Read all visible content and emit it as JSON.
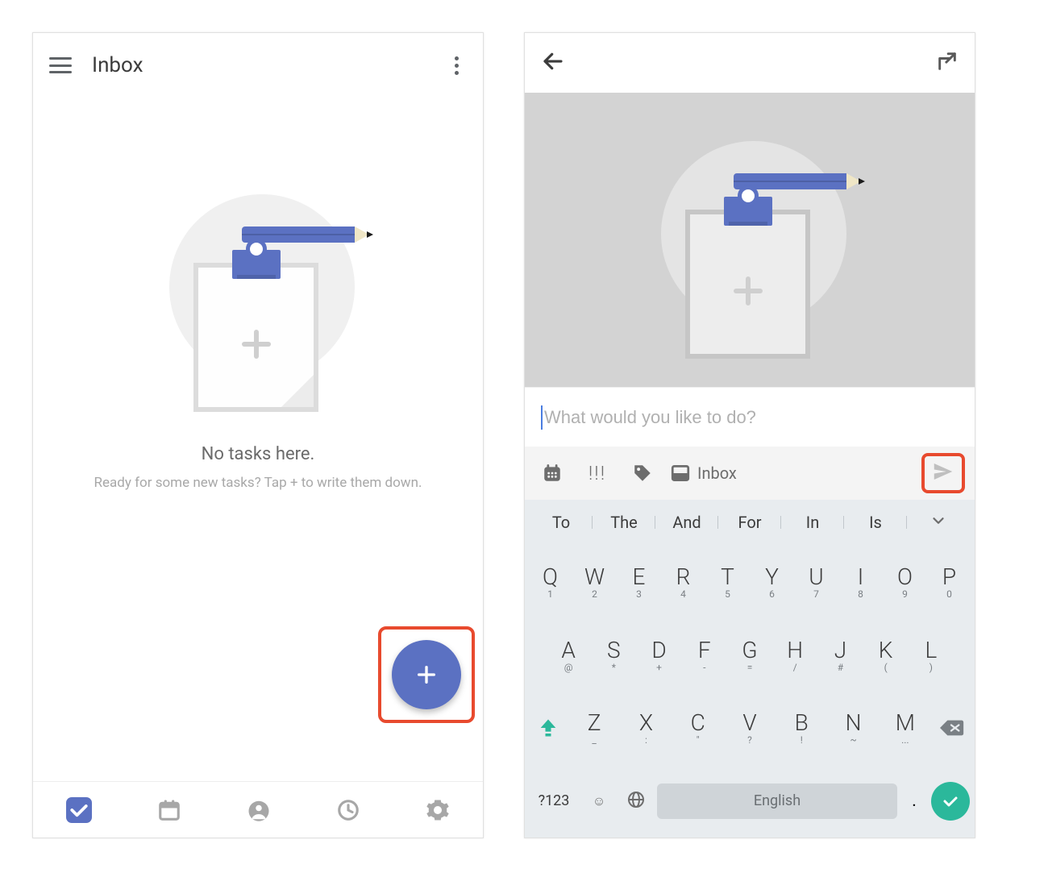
{
  "left": {
    "title": "Inbox",
    "empty_title": "No tasks here.",
    "empty_sub": "Ready for some new tasks? Tap + to write them down."
  },
  "right": {
    "placeholder": "What would you like to do?",
    "priority": "!!!",
    "list_label": "Inbox",
    "suggestions": [
      "To",
      "The",
      "And",
      "For",
      "In",
      "Is"
    ],
    "row1": [
      {
        "m": "Q",
        "s": "1"
      },
      {
        "m": "W",
        "s": "2"
      },
      {
        "m": "E",
        "s": "3"
      },
      {
        "m": "R",
        "s": "4"
      },
      {
        "m": "T",
        "s": "5"
      },
      {
        "m": "Y",
        "s": "6"
      },
      {
        "m": "U",
        "s": "7"
      },
      {
        "m": "I",
        "s": "8"
      },
      {
        "m": "O",
        "s": "9"
      },
      {
        "m": "P",
        "s": "0"
      }
    ],
    "row2": [
      {
        "m": "A",
        "s": "@"
      },
      {
        "m": "S",
        "s": "*"
      },
      {
        "m": "D",
        "s": "+"
      },
      {
        "m": "F",
        "s": "-"
      },
      {
        "m": "G",
        "s": "="
      },
      {
        "m": "H",
        "s": "/"
      },
      {
        "m": "J",
        "s": "#"
      },
      {
        "m": "K",
        "s": "("
      },
      {
        "m": "L",
        "s": ")"
      }
    ],
    "row3": [
      {
        "m": "Z",
        "s": "_"
      },
      {
        "m": "X",
        "s": ":"
      },
      {
        "m": "C",
        "s": "\""
      },
      {
        "m": "V",
        "s": "?"
      },
      {
        "m": "B",
        "s": "!"
      },
      {
        "m": "N",
        "s": "~"
      },
      {
        "m": "M",
        "s": "..."
      }
    ],
    "numswitch": "?123",
    "space_label": "English",
    "period": "."
  }
}
